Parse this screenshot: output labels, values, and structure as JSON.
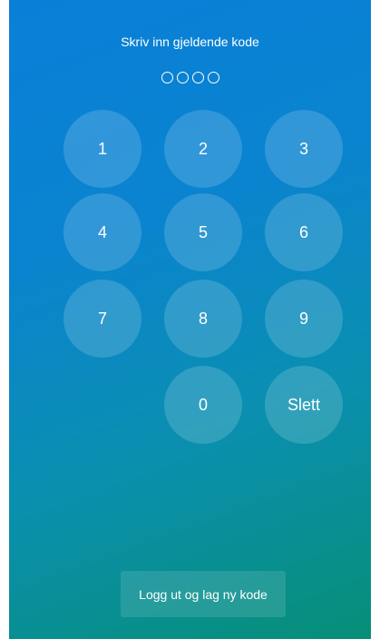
{
  "prompt": "Skriv inn gjeldende kode",
  "pin": {
    "length": 4,
    "entered": 0
  },
  "keypad": {
    "k1": "1",
    "k2": "2",
    "k3": "3",
    "k4": "4",
    "k5": "5",
    "k6": "6",
    "k7": "7",
    "k8": "8",
    "k9": "9",
    "k0": "0",
    "delete": "Slett"
  },
  "logout_button": "Logg ut og lag ny kode",
  "colors": {
    "gradient_top": "#0a7fd8",
    "gradient_bottom": "#078f78",
    "text": "#ffffff"
  }
}
